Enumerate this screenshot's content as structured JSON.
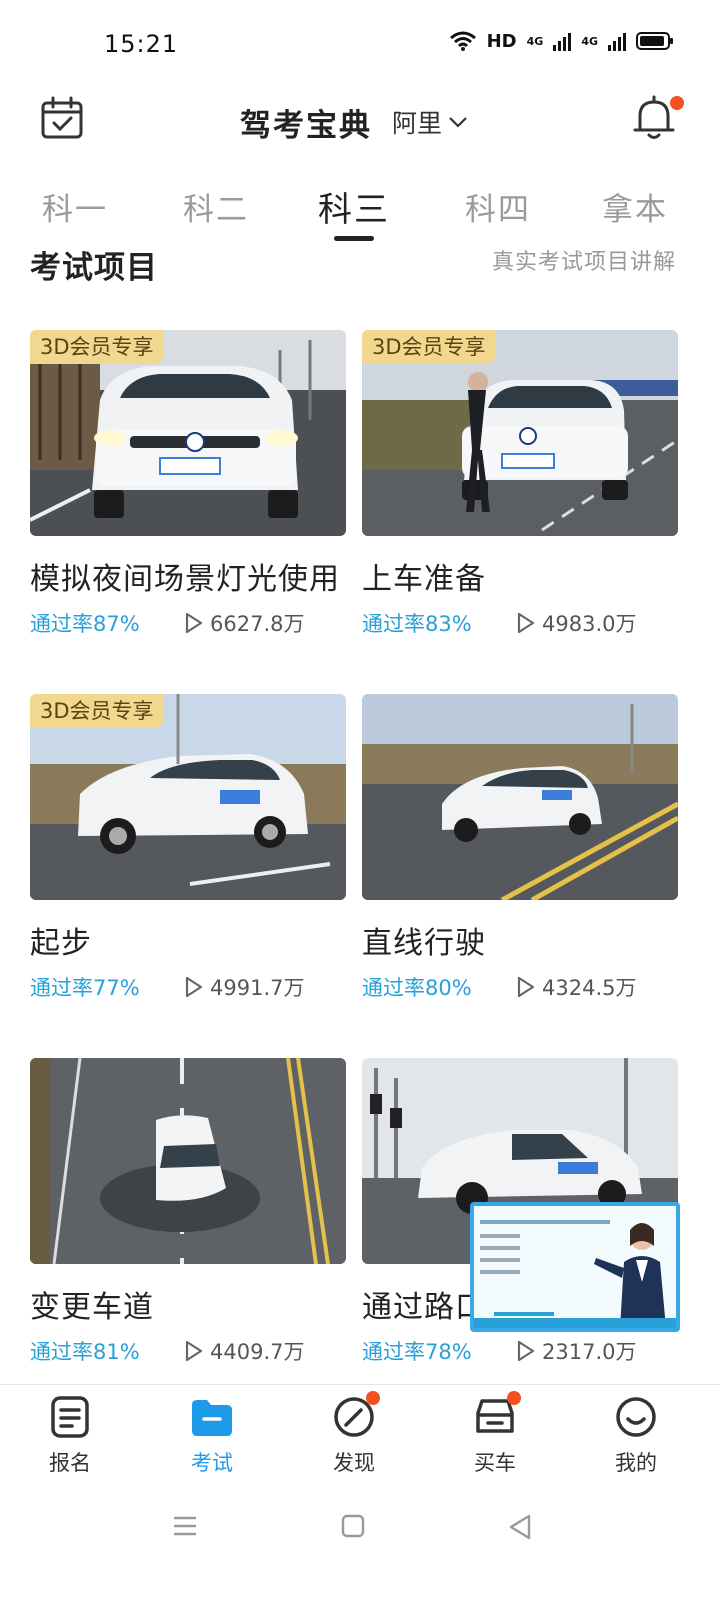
{
  "status_bar": {
    "time": "15:21",
    "network": "HD",
    "signal1": "4G",
    "signal2": "4G"
  },
  "header": {
    "title": "驾考宝典",
    "city": "阿里"
  },
  "tabs": [
    {
      "label": "科一"
    },
    {
      "label": "科二"
    },
    {
      "label": "科三"
    },
    {
      "label": "科四"
    },
    {
      "label": "拿本"
    }
  ],
  "section": {
    "title": "考试项目",
    "link": "真实考试项目讲解"
  },
  "badge_label": "3D会员专享",
  "cards": [
    {
      "title": "模拟夜间场景灯光使用",
      "rate": "通过率87%",
      "plays": "6627.8万"
    },
    {
      "title": "上车准备",
      "rate": "通过率83%",
      "plays": "4983.0万"
    },
    {
      "title": "起步",
      "rate": "通过率77%",
      "plays": "4991.7万"
    },
    {
      "title": "直线行驶",
      "rate": "通过率80%",
      "plays": "4324.5万"
    },
    {
      "title": "变更车道",
      "rate": "通过率81%",
      "plays": "4409.7万"
    },
    {
      "title": "通过路口",
      "rate": "通过率78%",
      "plays": "2317.0万"
    }
  ],
  "bottom_nav": [
    {
      "label": "报名",
      "icon": "form-icon"
    },
    {
      "label": "考试",
      "icon": "folder-icon"
    },
    {
      "label": "发现",
      "icon": "compass-icon"
    },
    {
      "label": "买车",
      "icon": "car-icon"
    },
    {
      "label": "我的",
      "icon": "smile-icon"
    }
  ],
  "colors": {
    "accent": "#1e9be8",
    "rate": "#2aa0d8",
    "badge_bg": "#f2d88f",
    "notify_dot": "#f4511e"
  }
}
